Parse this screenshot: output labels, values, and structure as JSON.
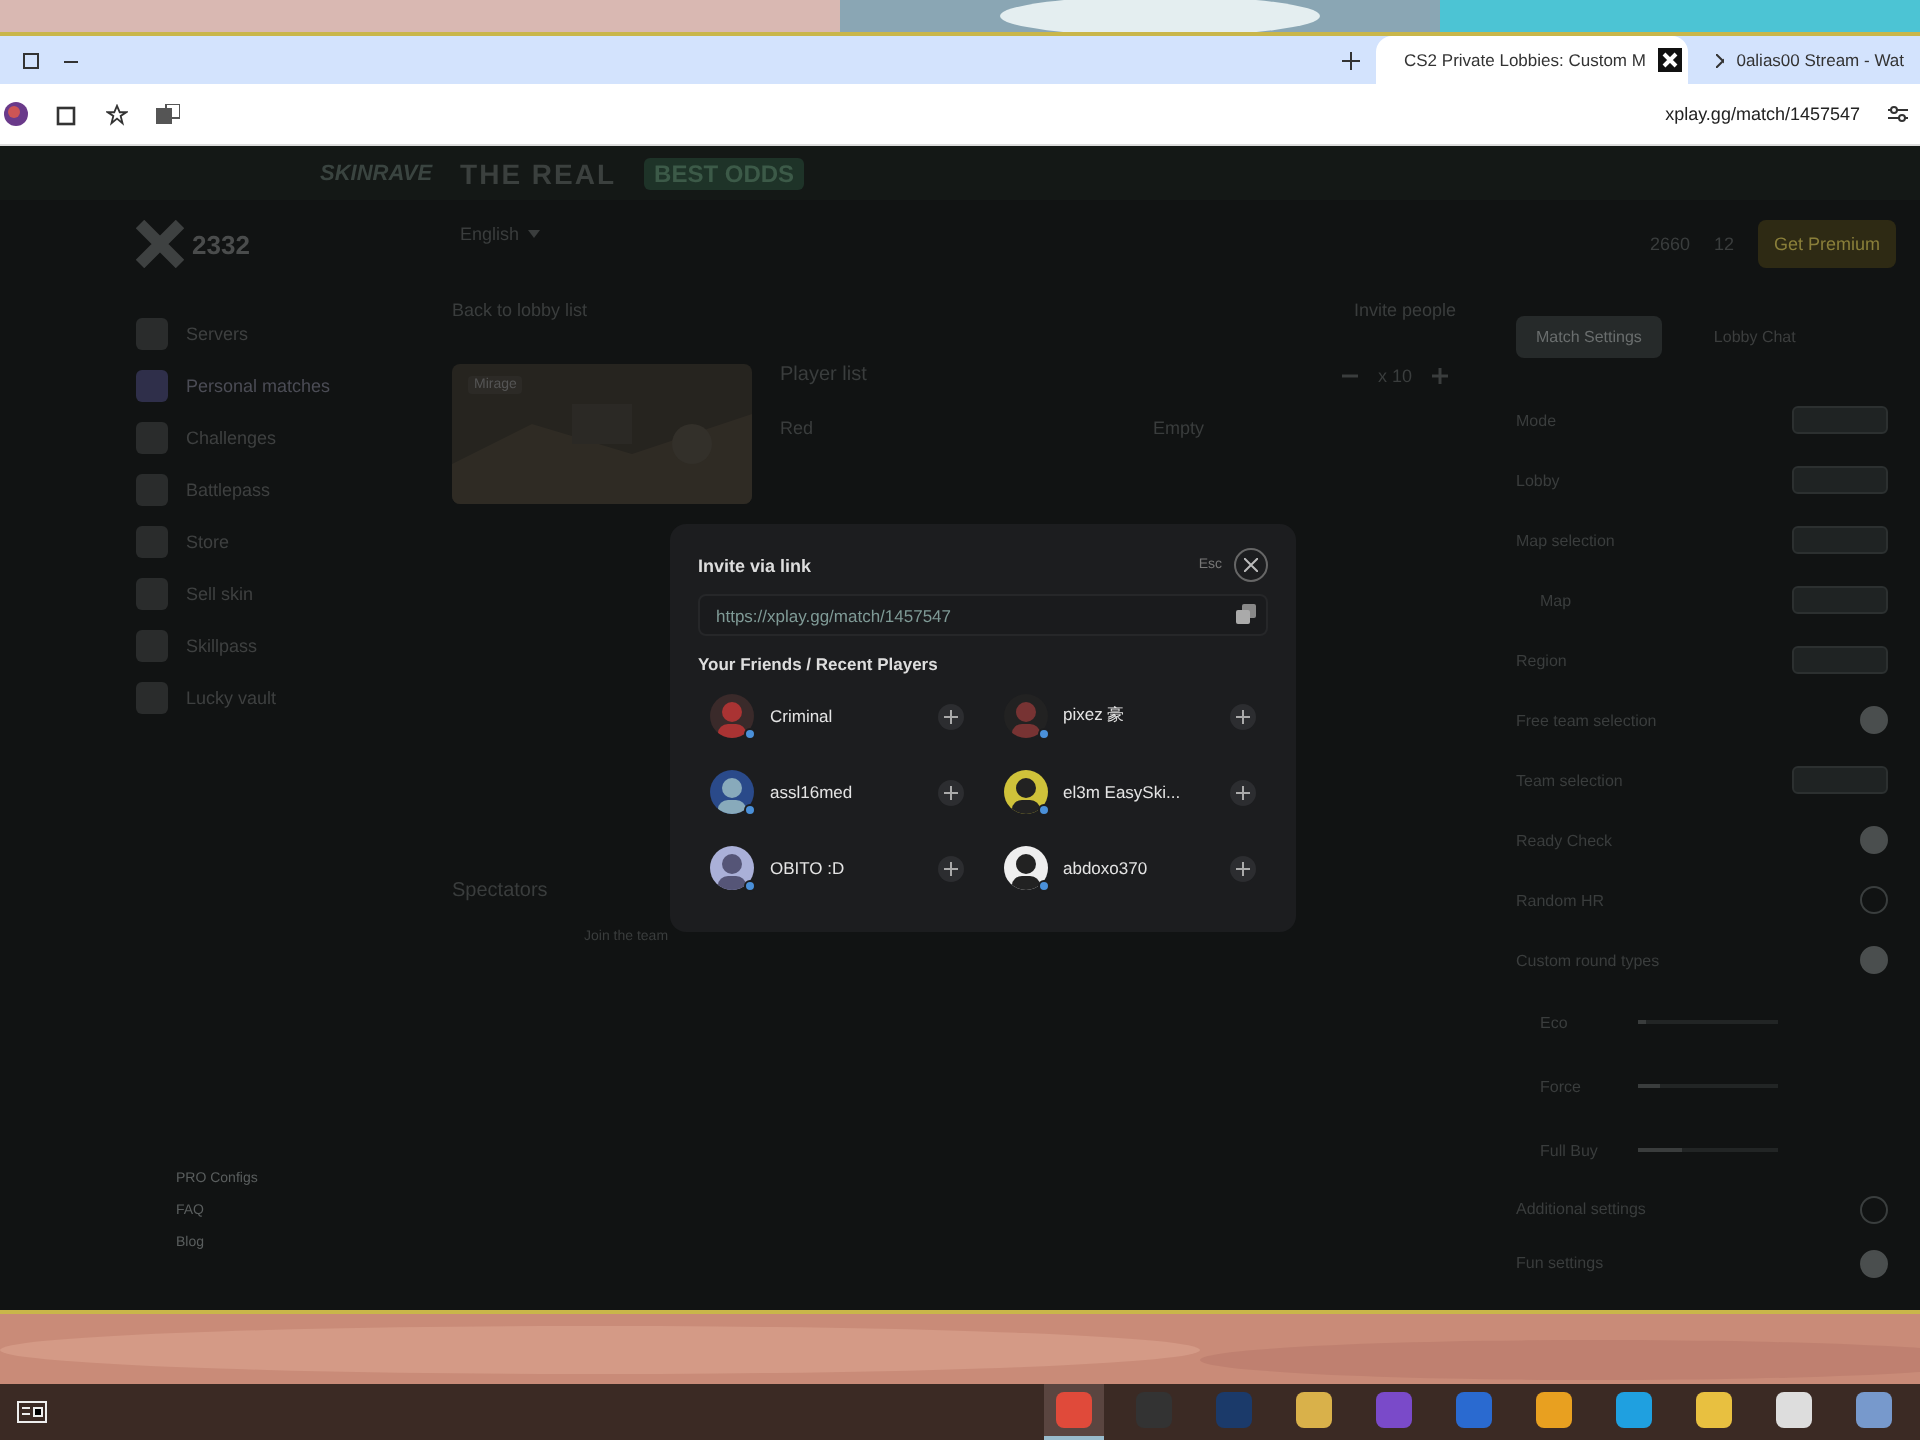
{
  "browser": {
    "tabs": [
      {
        "title": "CS2 Private Lobbies: Custom M",
        "selected": true
      },
      {
        "title": "0alias00 Stream - Wat",
        "selected": false
      }
    ],
    "url": "xplay.gg/match/1457547"
  },
  "banner": {
    "brand": "SKINRAVE",
    "headline": "THE REAL",
    "badge": "BEST ODDS"
  },
  "sidebar": {
    "points": "2332",
    "items": [
      {
        "label": "Servers",
        "selected": false
      },
      {
        "label": "Personal matches",
        "selected": true
      },
      {
        "label": "Challenges",
        "selected": false
      },
      {
        "label": "Battlepass",
        "selected": false
      },
      {
        "label": "Store",
        "selected": false
      },
      {
        "label": "Sell skin",
        "selected": false
      },
      {
        "label": "Skillpass",
        "selected": false
      },
      {
        "label": "Lucky vault",
        "selected": false
      }
    ],
    "footer_links": [
      "PRO Configs",
      "FAQ",
      "Blog"
    ]
  },
  "header": {
    "language": "English",
    "coins": "2660",
    "gems": "12",
    "premium_button": "Get Premium"
  },
  "lobby": {
    "back_link": "Back to lobby list",
    "invite_button": "Invite people",
    "map_tag": "Mirage",
    "player_list_title": "Player list",
    "team_size": "x 10",
    "players": [
      {
        "name": "Red"
      }
    ],
    "empty_slot": "Empty",
    "spectators_title": "Spectators",
    "join_button": "Join the team"
  },
  "settings": {
    "tabs": [
      {
        "label": "Match Settings",
        "selected": true
      },
      {
        "label": "Lobby Chat",
        "selected": false
      }
    ],
    "rows": [
      {
        "kind": "select",
        "label": "Mode"
      },
      {
        "kind": "select",
        "label": "Lobby"
      },
      {
        "kind": "select",
        "label": "Map selection"
      },
      {
        "kind": "subselect",
        "label": "Map"
      },
      {
        "kind": "select",
        "label": "Region"
      },
      {
        "kind": "toggle",
        "label": "Free team selection",
        "on": true
      },
      {
        "kind": "select",
        "label": "Team selection"
      },
      {
        "kind": "toggle",
        "label": "Ready Check",
        "on": true
      },
      {
        "kind": "toggle",
        "label": "Random HR",
        "on": false
      },
      {
        "kind": "toggle",
        "label": "Custom round types",
        "on": true
      },
      {
        "kind": "slider",
        "label": "Eco",
        "level": 0.05
      },
      {
        "kind": "slider",
        "label": "Force",
        "level": 0.15
      },
      {
        "kind": "slider",
        "label": "Full Buy",
        "level": 0.32
      },
      {
        "kind": "toggle",
        "label": "Additional settings",
        "on": false
      },
      {
        "kind": "toggle",
        "label": "Fun settings",
        "on": true
      }
    ]
  },
  "invite_dialog": {
    "title": "Invite via link",
    "esc_hint": "Esc",
    "link": "https://xplay.gg/match/1457547",
    "friends_title": "Your Friends / Recent Players",
    "friends": [
      {
        "name": "Criminal",
        "online": true
      },
      {
        "name": "pixez 豪",
        "online": true
      },
      {
        "name": "assl16med",
        "online": true
      },
      {
        "name": "el3m EasySki...",
        "online": true
      },
      {
        "name": "OBITO :D",
        "online": true
      },
      {
        "name": "abdoxo370",
        "online": true
      }
    ]
  }
}
